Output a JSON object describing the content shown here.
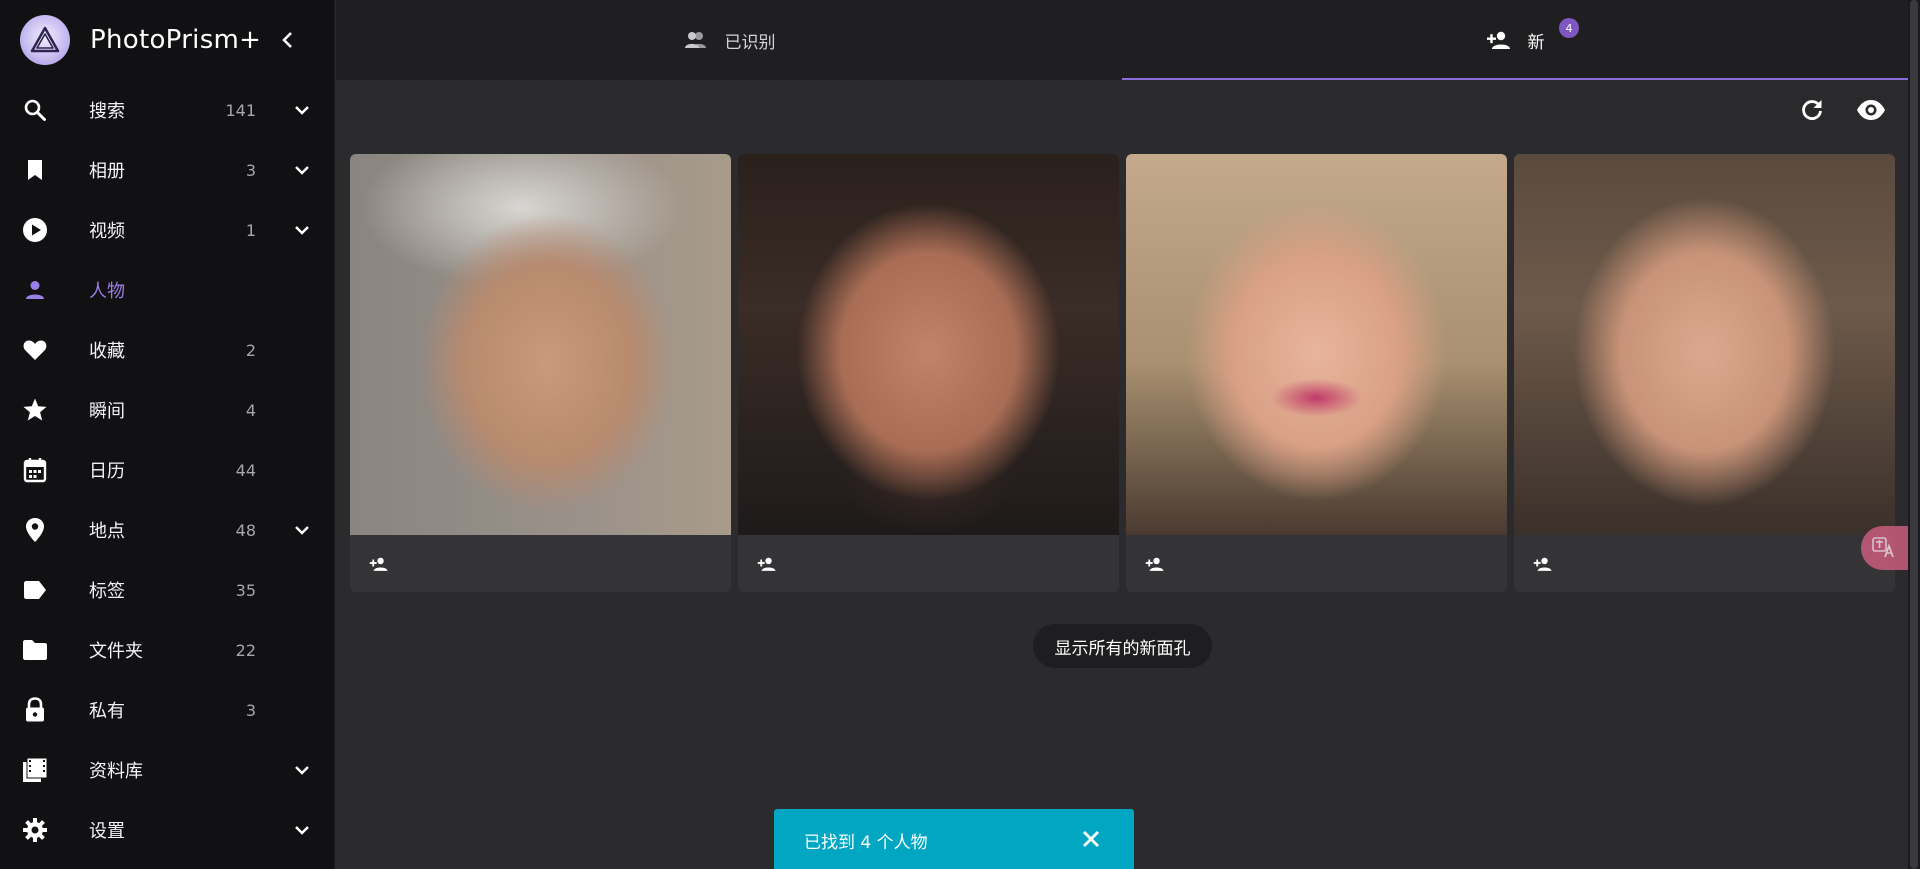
{
  "app": {
    "title": "PhotoPrism+"
  },
  "sidebar": {
    "items": [
      {
        "label": "搜索",
        "count": "141",
        "icon": "search-icon",
        "expand": true,
        "active": false
      },
      {
        "label": "相册",
        "count": "3",
        "icon": "bookmark-icon",
        "expand": true,
        "active": false
      },
      {
        "label": "视频",
        "count": "1",
        "icon": "play-circle-icon",
        "expand": true,
        "active": false
      },
      {
        "label": "人物",
        "count": "",
        "icon": "person-icon",
        "expand": false,
        "active": true
      },
      {
        "label": "收藏",
        "count": "2",
        "icon": "heart-icon",
        "expand": false,
        "active": false
      },
      {
        "label": "瞬间",
        "count": "4",
        "icon": "star-icon",
        "expand": false,
        "active": false
      },
      {
        "label": "日历",
        "count": "44",
        "icon": "calendar-icon",
        "expand": false,
        "active": false
      },
      {
        "label": "地点",
        "count": "48",
        "icon": "location-pin-icon",
        "expand": true,
        "active": false
      },
      {
        "label": "标签",
        "count": "35",
        "icon": "label-icon",
        "expand": false,
        "active": false
      },
      {
        "label": "文件夹",
        "count": "22",
        "icon": "folder-icon",
        "expand": false,
        "active": false
      },
      {
        "label": "私有",
        "count": "3",
        "icon": "lock-icon",
        "expand": false,
        "active": false
      },
      {
        "label": "资料库",
        "count": "",
        "icon": "film-library-icon",
        "expand": true,
        "active": false
      },
      {
        "label": "设置",
        "count": "",
        "icon": "gear-icon",
        "expand": true,
        "active": false
      }
    ]
  },
  "tabs": [
    {
      "label": "已识别",
      "icon": "people-icon",
      "active": false
    },
    {
      "label": "新",
      "icon": "person-add-icon",
      "active": true,
      "badge": "4"
    }
  ],
  "toolbar": {
    "refresh_icon": "refresh-icon",
    "visibility_icon": "eye-icon"
  },
  "faces": [
    {
      "name": "",
      "icon": "person-add-icon"
    },
    {
      "name": "",
      "icon": "person-add-icon"
    },
    {
      "name": "",
      "icon": "person-add-icon"
    },
    {
      "name": "",
      "icon": "person-add-icon"
    }
  ],
  "main": {
    "show_all_label": "显示所有的新面孔"
  },
  "snackbar": {
    "message": "已找到 4 个人物",
    "close_icon": "close-icon"
  },
  "colors": {
    "accent": "#8a6ee0",
    "active_nav": "#9b7fe6",
    "snackbar": "#00a6c2",
    "badge": "#7e57c2"
  }
}
